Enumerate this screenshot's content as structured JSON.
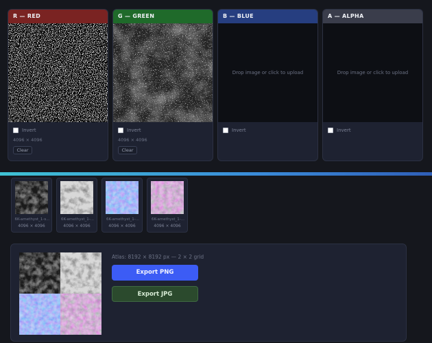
{
  "channels": [
    {
      "title": "R — RED",
      "header_color": "#7a2322",
      "invert_label": "Invert",
      "dims": "4096 × 4096",
      "clear_label": "Clear",
      "preview": "white-noise"
    },
    {
      "title": "G — GREEN",
      "header_color": "#1f6a2a",
      "invert_label": "Invert",
      "dims": "4096 × 4096",
      "clear_label": "Clear",
      "preview": "dark-noise"
    },
    {
      "title": "B — BLUE",
      "header_color": "#263e80",
      "invert_label": "Invert",
      "drop_text": "Drop image or click to upload"
    },
    {
      "title": "A — ALPHA",
      "header_color": "#3a3d4b",
      "invert_label": "Invert",
      "drop_text": "Drop image or click to upload"
    }
  ],
  "textures": [
    {
      "name": "6K-amethyst_1-s...",
      "dims": "4096 × 4096"
    },
    {
      "name": "6K-amethyst_1-...",
      "dims": "4096 × 4096"
    },
    {
      "name": "6K-amethyst_1-...",
      "dims": "4096 × 4096"
    },
    {
      "name": "6K-amethyst_1-...",
      "dims": "4096 × 4096"
    }
  ],
  "atlas": {
    "info": "Atlas: 8192 × 8192 px — 2 × 2 grid",
    "export_png": "Export PNG",
    "export_jpg": "Export JPG"
  },
  "colors": {
    "accent_primary": "#3c5cf5",
    "accent_gradient_start": "#3fc2d4",
    "export_jpg_bg": "#2b4a2d"
  }
}
